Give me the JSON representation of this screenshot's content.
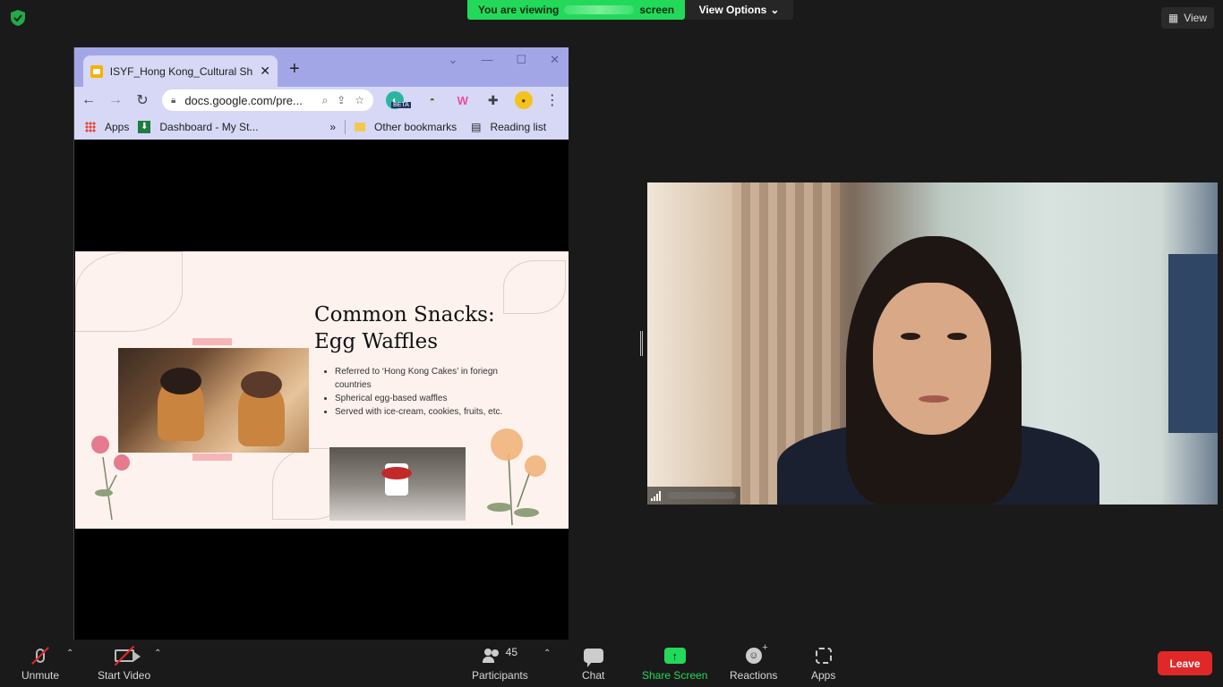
{
  "top_bar": {
    "viewing_prefix": "You are viewing",
    "viewing_suffix": "screen",
    "view_options_label": "View Options",
    "view_label": "View",
    "colors": {
      "viewing_banner": "#23d959",
      "background": "#1a1a1a"
    }
  },
  "browser": {
    "tab_title": "ISYF_Hong Kong_Cultural Shar",
    "new_tab_icon": "plus-icon",
    "address": "docs.google.com/pre...",
    "extension_beta_badge": "BETA",
    "bookmarks": {
      "apps": "Apps",
      "dashboard": "Dashboard - My St...",
      "more": "»",
      "other": "Other bookmarks",
      "reading_list": "Reading list"
    },
    "colors": {
      "frame": "#a3a6e6",
      "toolbar": "#d6d8f5"
    }
  },
  "slide": {
    "title_line1": "Common Snacks:",
    "title_line2": "Egg Waffles",
    "bullets": [
      "Referred to ‘Hong Kong Cakes’ in foriegn countries",
      "Spherical egg-based waffles",
      "Served with ice-cream, cookies, fruits, etc."
    ],
    "background_color": "#fdf2ee"
  },
  "controls": {
    "unmute": "Unmute",
    "start_video": "Start Video",
    "participants": "Participants",
    "participants_count": "45",
    "chat": "Chat",
    "share_screen": "Share Screen",
    "reactions": "Reactions",
    "apps": "Apps",
    "leave": "Leave",
    "colors": {
      "leave": "#e02828",
      "share": "#23d959",
      "mute_slash": "#e02828"
    }
  }
}
